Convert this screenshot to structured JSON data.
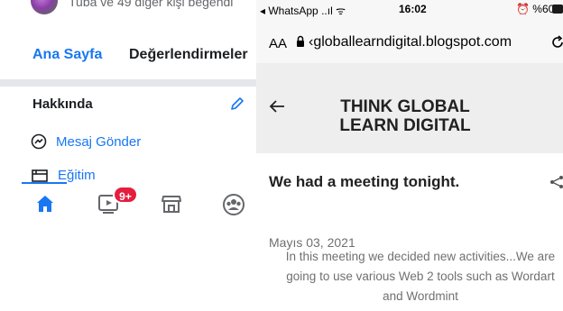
{
  "facebook": {
    "likes_text": "Tuba ve 49 diğer kişi beğendi",
    "tabs": [
      {
        "label": "Ana Sayfa",
        "active": true
      },
      {
        "label": "Değerlendirmeler",
        "active": false
      }
    ],
    "about": {
      "title": "Hakkında",
      "send_message": "Mesaj Gönder",
      "education": "Eğitim"
    },
    "bottom_nav": {
      "icons": [
        "home-icon",
        "video-icon",
        "marketplace-icon",
        "groups-icon"
      ],
      "video_badge": "9+"
    },
    "colors": {
      "accent": "#1877f2",
      "badge": "#e41e3f",
      "separator": "#e4e6eb"
    }
  },
  "safari": {
    "status": {
      "back_app": "◂ WhatsApp",
      "time": "16:02",
      "battery": "%60"
    },
    "address": {
      "text_size": "AA",
      "url": "globallearndigital.blogspot.com"
    },
    "blog": {
      "title_line1": "THINK GLOBAL",
      "title_line2": "LEARN DIGITAL"
    },
    "post": {
      "title": "We had a meeting tonight.",
      "date": "Mayıs 03, 2021",
      "body_line1": "In this meeting we decided new activities...We are",
      "body_line2": "going to use various Web 2 tools such as Wordart",
      "body_line3": "and Wordmint"
    },
    "colors": {
      "header_bg": "#eeeeee",
      "bar_bg": "#f7f7f7",
      "muted_text": "#707070"
    }
  }
}
